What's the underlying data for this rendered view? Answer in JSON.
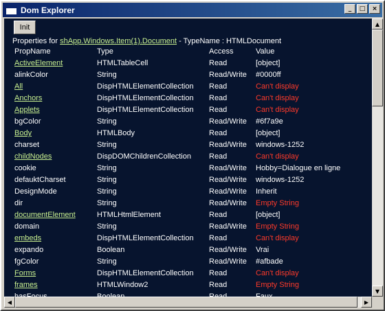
{
  "window": {
    "title": "Dom Explorer",
    "buttons": {
      "minimize": "_",
      "maximize": "□",
      "close": "×"
    }
  },
  "toolbar": {
    "init_label": "Init"
  },
  "properties": {
    "prefix": "Properties for ",
    "target": "shApp.Windows.Item(1).Document",
    "suffix": " - TypeName : HTMLDocument"
  },
  "columns": {
    "name": "PropName",
    "type": "Type",
    "access": "Access",
    "value": "Value"
  },
  "rows": [
    {
      "name": "ActiveElement",
      "link": true,
      "type": "HTMLTableCell",
      "access": "Read",
      "value": "[object]",
      "error": false
    },
    {
      "name": "alinkColor",
      "link": false,
      "type": "String",
      "access": "Read/Write",
      "value": "#0000ff",
      "error": false
    },
    {
      "name": "All",
      "link": true,
      "type": "DispHTMLElementCollection",
      "access": "Read",
      "value": "Can't display",
      "error": true
    },
    {
      "name": "Anchors",
      "link": true,
      "type": "DispHTMLElementCollection",
      "access": "Read",
      "value": "Can't display",
      "error": true
    },
    {
      "name": "Applets",
      "link": true,
      "type": "DispHTMLElementCollection",
      "access": "Read",
      "value": "Can't display",
      "error": true
    },
    {
      "name": "bgColor",
      "link": false,
      "type": "String",
      "access": "Read/Write",
      "value": "#6f7a9e",
      "error": false
    },
    {
      "name": "Body",
      "link": true,
      "type": "HTMLBody",
      "access": "Read",
      "value": "[object]",
      "error": false
    },
    {
      "name": "charset",
      "link": false,
      "type": "String",
      "access": "Read/Write",
      "value": "windows-1252",
      "error": false
    },
    {
      "name": "childNodes",
      "link": true,
      "type": "DispDOMChildrenCollection",
      "access": "Read",
      "value": "Can't display",
      "error": true
    },
    {
      "name": "cookie",
      "link": false,
      "type": "String",
      "access": "Read/Write",
      "value": "Hobby=Dialogue en ligne",
      "error": false
    },
    {
      "name": "defauktCharset",
      "link": false,
      "type": "String",
      "access": "Read/Write",
      "value": "windows-1252",
      "error": false
    },
    {
      "name": "DesignMode",
      "link": false,
      "type": "String",
      "access": "Read/Write",
      "value": "Inherit",
      "error": false
    },
    {
      "name": "dir",
      "link": false,
      "type": "String",
      "access": "Read/Write",
      "value": "Empty String",
      "error": true
    },
    {
      "name": "documentElement",
      "link": true,
      "type": "HTMLHtmlElement",
      "access": "Read",
      "value": "[object]",
      "error": false
    },
    {
      "name": "domain",
      "link": false,
      "type": "String",
      "access": "Read/Write",
      "value": "Empty String",
      "error": true
    },
    {
      "name": "embeds",
      "link": true,
      "type": "DispHTMLElementCollection",
      "access": "Read",
      "value": "Can't display",
      "error": true
    },
    {
      "name": "expando",
      "link": false,
      "type": "Boolean",
      "access": "Read/Write",
      "value": "Vrai",
      "error": false
    },
    {
      "name": "fgColor",
      "link": false,
      "type": "String",
      "access": "Read/Write",
      "value": "#afbade",
      "error": false
    },
    {
      "name": "Forms",
      "link": true,
      "type": "DispHTMLElementCollection",
      "access": "Read",
      "value": "Can't display",
      "error": true
    },
    {
      "name": "frames",
      "link": true,
      "type": "HTMLWindow2",
      "access": "Read",
      "value": "Empty String",
      "error": true
    },
    {
      "name": "hasFocus",
      "link": false,
      "type": "Boolean",
      "access": "Read",
      "value": "Faux",
      "error": false
    }
  ],
  "scrollbars": {
    "vertical": {
      "up": "▲",
      "down": "▼"
    },
    "horizontal": {
      "left": "◀",
      "right": "▶"
    }
  },
  "colors": {
    "background": "#07142e",
    "link": "#c8f090",
    "error": "#ff3a2a",
    "title_start": "#0a246a",
    "title_end": "#3a6ea5"
  }
}
